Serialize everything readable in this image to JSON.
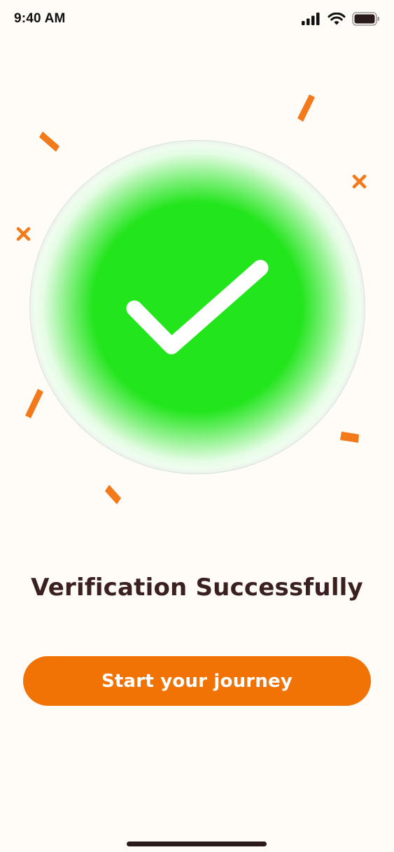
{
  "status_bar": {
    "time": "9:40 AM",
    "icons": [
      "cellular-signal-icon",
      "wifi-icon",
      "battery-icon"
    ]
  },
  "success": {
    "icon": "checkmark-icon",
    "title": "Verification Successfully"
  },
  "actions": {
    "primary_label": "Start your journey"
  },
  "decorations": {
    "confetti": [
      "confetti-dash",
      "confetti-x"
    ]
  },
  "colors": {
    "background": "#FFFBF6",
    "accent": "#F17205",
    "success_green": "#22E51C",
    "title_text": "#3A2120",
    "confetti": "#F27A1A"
  }
}
